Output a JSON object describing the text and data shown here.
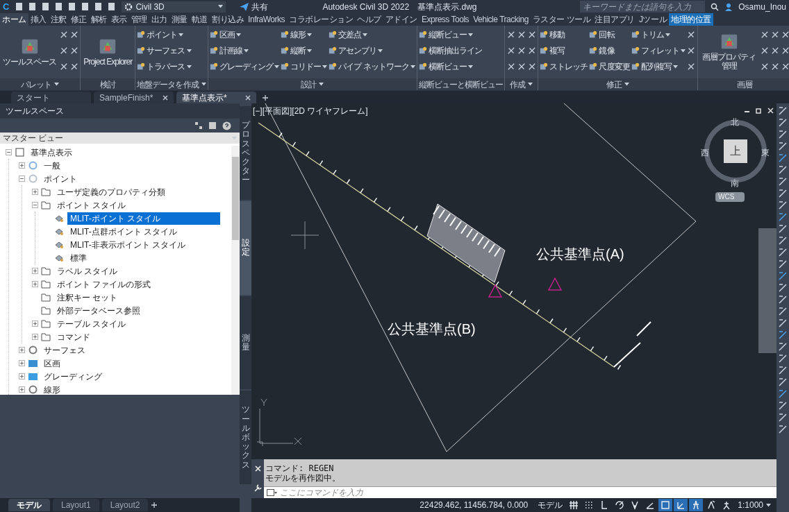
{
  "title_bar": {
    "app_button": "C",
    "workspace": "Civil 3D",
    "share": "共有",
    "title": "Autodesk Civil 3D 2022　基準点表示.dwg",
    "search": {
      "placeholder": "キーワードまたは語句を入力"
    },
    "user": "Osamu_Inou"
  },
  "ribbon_tabs": [
    {
      "label": "ホーム",
      "selected": true,
      "kind": "normal"
    },
    {
      "label": "挿入",
      "selected": false,
      "kind": "normal"
    },
    {
      "label": "注釈",
      "selected": false,
      "kind": "normal"
    },
    {
      "label": "修正",
      "selected": false,
      "kind": "normal"
    },
    {
      "label": "解析",
      "selected": false,
      "kind": "normal"
    },
    {
      "label": "表示",
      "selected": false,
      "kind": "normal"
    },
    {
      "label": "管理",
      "selected": false,
      "kind": "normal"
    },
    {
      "label": "出力",
      "selected": false,
      "kind": "normal"
    },
    {
      "label": "測量",
      "selected": false,
      "kind": "normal"
    },
    {
      "label": "軌道",
      "selected": false,
      "kind": "normal"
    },
    {
      "label": "割り込み",
      "selected": false,
      "kind": "normal"
    },
    {
      "label": "InfraWorks",
      "selected": false,
      "kind": "normal"
    },
    {
      "label": "コラボレーション",
      "selected": false,
      "kind": "normal"
    },
    {
      "label": "ヘルプ",
      "selected": false,
      "kind": "normal"
    },
    {
      "label": "アドイン",
      "selected": false,
      "kind": "normal"
    },
    {
      "label": "Express Tools",
      "selected": false,
      "kind": "normal"
    },
    {
      "label": "Vehicle Tracking",
      "selected": false,
      "kind": "normal"
    },
    {
      "label": "ラスター ツール",
      "selected": false,
      "kind": "normal"
    },
    {
      "label": "注目アプリ",
      "selected": false,
      "kind": "normal"
    },
    {
      "label": "Jツール",
      "selected": false,
      "kind": "normal"
    },
    {
      "label": "地理的位置",
      "selected": false,
      "kind": "contextual"
    }
  ],
  "ribbon_panels": [
    {
      "title": "パレット",
      "menu": true,
      "columns": [
        [
          {
            "kind": "large",
            "label": "ツールスペース",
            "dropdown": false
          }
        ],
        [
          {
            "kind": "icon"
          },
          {
            "kind": "icon"
          },
          {
            "kind": "icon"
          }
        ],
        [
          {
            "kind": "icon"
          },
          {
            "kind": "icon"
          },
          {
            "kind": "icon"
          }
        ]
      ]
    },
    {
      "title": "検討",
      "menu": false,
      "columns": [
        [
          {
            "kind": "large",
            "label": "Project Explorer",
            "dropdown": false
          }
        ]
      ]
    },
    {
      "title": "地盤データを作成",
      "menu": true,
      "columns": [
        [
          {
            "kind": "small",
            "label": "ポイント",
            "dropdown": true
          },
          {
            "kind": "small",
            "label": "サーフェス",
            "dropdown": true
          },
          {
            "kind": "small",
            "label": "トラバース",
            "dropdown": true
          }
        ]
      ]
    },
    {
      "title": "設計",
      "menu": true,
      "columns": [
        [
          {
            "kind": "small",
            "label": "区画",
            "dropdown": true
          },
          {
            "kind": "small",
            "label": "計画線",
            "dropdown": true
          },
          {
            "kind": "small",
            "label": "グレーディング",
            "dropdown": true
          }
        ],
        [
          {
            "kind": "small",
            "label": "線形",
            "dropdown": true
          },
          {
            "kind": "small",
            "label": "縦断",
            "dropdown": true
          },
          {
            "kind": "small",
            "label": "コリドー",
            "dropdown": true
          }
        ],
        [
          {
            "kind": "small",
            "label": "交差点",
            "dropdown": true
          },
          {
            "kind": "small",
            "label": "アセンブリ",
            "dropdown": true
          },
          {
            "kind": "small",
            "label": "パイプ ネットワーク",
            "dropdown": true
          }
        ]
      ]
    },
    {
      "title": "縦断ビューと横断ビュー",
      "menu": false,
      "columns": [
        [
          {
            "kind": "small",
            "label": "縦断ビュー",
            "dropdown": true
          },
          {
            "kind": "small",
            "label": "横断抽出ライン",
            "dropdown": false
          },
          {
            "kind": "small",
            "label": "横断ビュー",
            "dropdown": true
          }
        ]
      ]
    },
    {
      "title": "作成",
      "menu": true,
      "columns": [
        [
          {
            "kind": "icon"
          },
          {
            "kind": "icon"
          },
          {
            "kind": "icon"
          }
        ],
        [
          {
            "kind": "icon"
          },
          {
            "kind": "icon"
          },
          {
            "kind": "icon"
          }
        ],
        [
          {
            "kind": "icon"
          },
          {
            "kind": "icon"
          },
          {
            "kind": "icon"
          }
        ]
      ]
    },
    {
      "title": "修正",
      "menu": true,
      "columns": [
        [
          {
            "kind": "small",
            "label": "移動",
            "dropdown": false
          },
          {
            "kind": "small",
            "label": "複写",
            "dropdown": false
          },
          {
            "kind": "small",
            "label": "ストレッチ",
            "dropdown": false
          }
        ],
        [
          {
            "kind": "small",
            "label": "回転",
            "dropdown": false
          },
          {
            "kind": "small",
            "label": "鏡像",
            "dropdown": false
          },
          {
            "kind": "small",
            "label": "尺度変更",
            "dropdown": false
          }
        ],
        [
          {
            "kind": "small",
            "label": "トリム",
            "dropdown": true
          },
          {
            "kind": "small",
            "label": "フィレット",
            "dropdown": true
          },
          {
            "kind": "small",
            "label": "配列複写",
            "dropdown": true
          }
        ],
        [
          {
            "kind": "icon"
          },
          {
            "kind": "icon"
          },
          {
            "kind": "icon"
          }
        ]
      ]
    },
    {
      "title": "画層",
      "menu": false,
      "columns": [
        [
          {
            "kind": "large",
            "label": "画層プロパティ管理",
            "dropdown": false
          }
        ],
        [
          {
            "kind": "icon"
          },
          {
            "kind": "icon"
          },
          {
            "kind": "icon"
          }
        ],
        [
          {
            "kind": "icon"
          },
          {
            "kind": "icon"
          },
          {
            "kind": "icon"
          }
        ],
        [
          {
            "kind": "icon"
          },
          {
            "kind": "icon"
          },
          {
            "kind": "icon"
          }
        ]
      ]
    }
  ],
  "document_tabs": [
    {
      "label": "スタート",
      "selected": false,
      "closable": false
    },
    {
      "label": "SampleFinish*",
      "selected": false,
      "closable": true
    },
    {
      "label": "基準点表示*",
      "selected": true,
      "closable": true
    }
  ],
  "toolspace": {
    "title": "ツールスペース",
    "view": "マスター ビュー",
    "side_tabs": [
      {
        "label": "プロスペクター",
        "selected": false
      },
      {
        "label": "設定",
        "selected": true
      },
      {
        "label": "測量",
        "selected": false
      },
      {
        "label": "ツールボックス",
        "selected": false
      }
    ],
    "tree": [
      {
        "label": "基準点表示",
        "kind": "drawing",
        "expanded": true,
        "selected": false,
        "children": [
          {
            "label": "一般",
            "kind": "settings",
            "expanded": false,
            "selected": false
          },
          {
            "label": "ポイント",
            "kind": "point",
            "expanded": true,
            "selected": false,
            "children": [
              {
                "label": "ユーザ定義のプロパティ分類",
                "kind": "folder",
                "expanded": false,
                "selected": false
              },
              {
                "label": "ポイント スタイル",
                "kind": "folder",
                "expanded": true,
                "selected": false,
                "children": [
                  {
                    "label": "MLIT-ポイント スタイル",
                    "kind": "style",
                    "selected": true
                  },
                  {
                    "label": "MLIT-点群ポイント スタイル",
                    "kind": "style",
                    "selected": false
                  },
                  {
                    "label": "MLIT-非表示ポイント スタイル",
                    "kind": "style",
                    "selected": false
                  },
                  {
                    "label": "標準",
                    "kind": "style",
                    "selected": false
                  }
                ]
              },
              {
                "label": "ラベル スタイル",
                "kind": "folder",
                "expanded": false,
                "selected": false
              },
              {
                "label": "ポイント ファイルの形式",
                "kind": "folder",
                "expanded": false,
                "selected": false
              },
              {
                "label": "注釈キー セット",
                "kind": "folder",
                "selected": false
              },
              {
                "label": "外部データベース参照",
                "kind": "folder",
                "selected": false
              },
              {
                "label": "テーブル スタイル",
                "kind": "folder",
                "expanded": false,
                "selected": false
              },
              {
                "label": "コマンド",
                "kind": "folder",
                "expanded": false,
                "selected": false
              }
            ]
          },
          {
            "label": "サーフェス",
            "kind": "surface",
            "expanded": false,
            "selected": false
          },
          {
            "label": "区画",
            "kind": "parcel",
            "expanded": false,
            "selected": false
          },
          {
            "label": "グレーディング",
            "kind": "grading",
            "expanded": false,
            "selected": false
          },
          {
            "label": "線形",
            "kind": "alignment",
            "expanded": false,
            "selected": false
          }
        ]
      }
    ]
  },
  "viewport": {
    "label": "[−][平面図][2D ワイヤフレーム]",
    "annotations": [
      "公共基準点(A)",
      "公共基準点(B)"
    ],
    "viewcube": {
      "north": "北",
      "south": "南",
      "east": "東",
      "west": "西",
      "face": "上",
      "ucs": "WCS"
    }
  },
  "command_line": {
    "history": [
      "コマンド:  REGEN",
      "モデルを再作図中。"
    ],
    "input": {
      "placeholder": "ここにコマンドを入力"
    }
  },
  "layout_tabs": [
    {
      "label": "モデル",
      "selected": true
    },
    {
      "label": "Layout1",
      "selected": false
    },
    {
      "label": "Layout2",
      "selected": false
    }
  ],
  "status_bar": {
    "coordinates": "22429.462, 11456.784, 0.000",
    "space": "モデル",
    "toggles": [
      {
        "kind": "grid",
        "on": false
      },
      {
        "kind": "snap",
        "on": false
      },
      {
        "kind": "ortho",
        "on": false
      },
      {
        "kind": "polar",
        "on": false
      },
      {
        "kind": "isodraft",
        "on": false
      },
      {
        "kind": "angle",
        "on": false
      },
      {
        "kind": "osnap",
        "on": true
      },
      {
        "kind": "dynucs",
        "on": true
      },
      {
        "kind": "annotation",
        "on": true
      },
      {
        "kind": "autoscale",
        "on": false
      },
      {
        "kind": "scale_person",
        "on": false
      }
    ],
    "scale": "1:1000"
  }
}
